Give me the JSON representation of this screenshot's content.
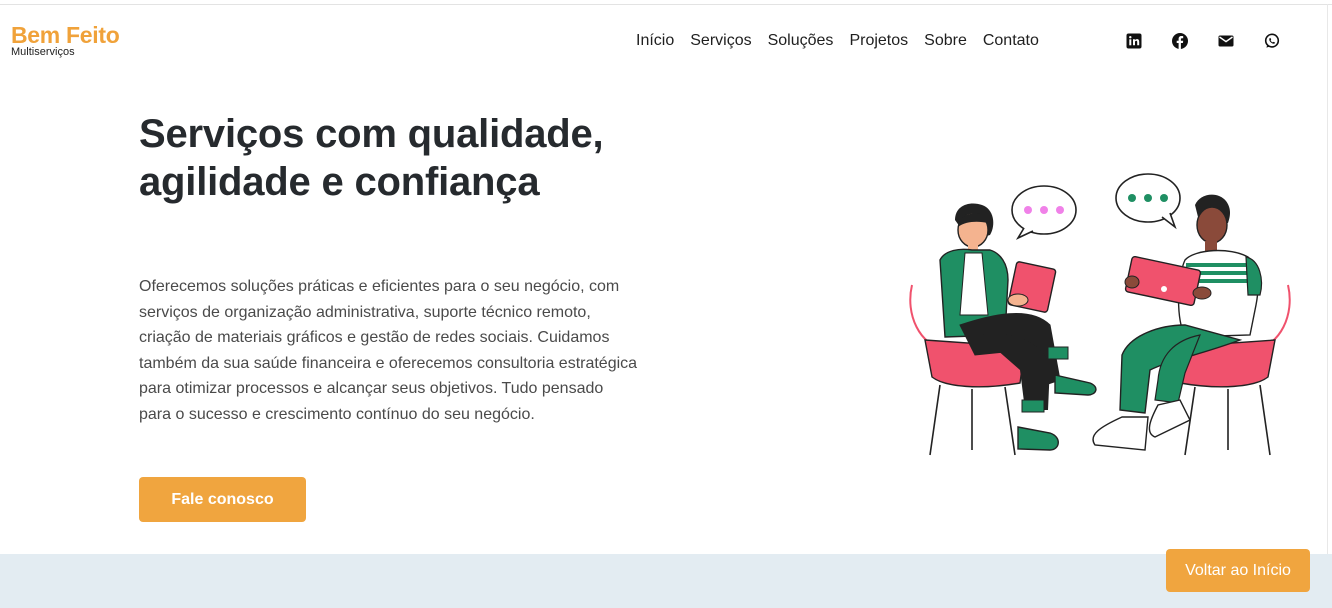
{
  "brand": {
    "name": "Bem Feito",
    "tagline": "Multiserviços"
  },
  "nav": {
    "items": [
      "Início",
      "Serviços",
      "Soluções",
      "Projetos",
      "Sobre",
      "Contato"
    ]
  },
  "social": {
    "icons": [
      "linkedin-icon",
      "facebook-icon",
      "email-icon",
      "whatsapp-icon"
    ]
  },
  "hero": {
    "title_line1": "Serviços com qualidade,",
    "title_line2": "agilidade e confiança",
    "description": "Oferecemos soluções práticas e eficientes para o seu negócio, com serviços de organização administrativa, suporte técnico remoto, criação de materiais gráficos e gestão de redes sociais. Cuidamos também da sua saúde financeira e oferecemos consultoria estratégica para otimizar processos e alcançar seus objetivos. Tudo pensado para o sucesso e crescimento contínuo do seu negócio.",
    "cta_label": "Fale conosco"
  },
  "back_to_top": {
    "label": "Voltar ao Início"
  },
  "colors": {
    "accent": "#f0a53f",
    "brand": "#f0a23a",
    "band": "#e3ecf2",
    "illustration_green": "#1f8f63",
    "illustration_pink": "#f0526d"
  }
}
